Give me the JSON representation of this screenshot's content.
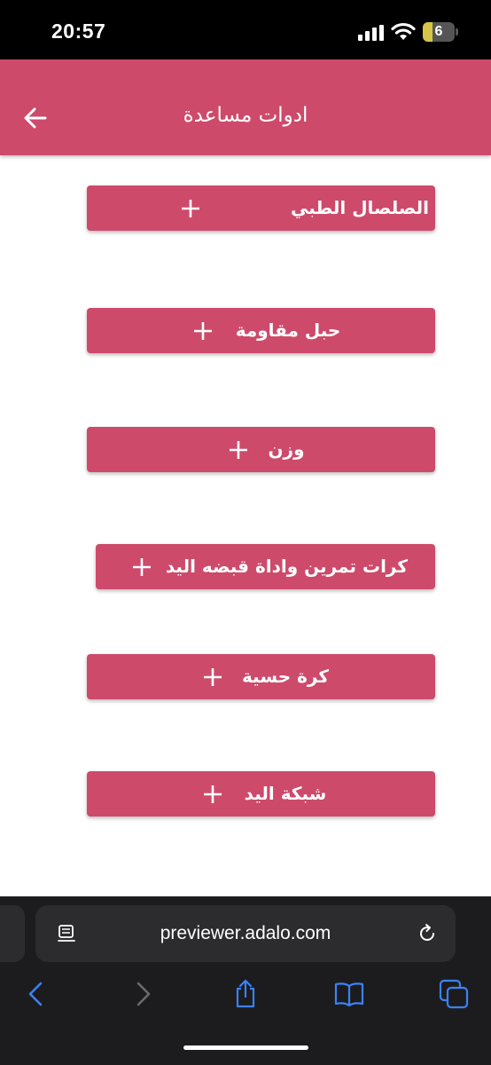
{
  "status_bar": {
    "time": "20:57",
    "battery_level": "6"
  },
  "header": {
    "title": "ادوات مساعدة",
    "background_color": "#cd4a6b"
  },
  "tools": [
    {
      "label": "الصلصال الطبي",
      "icon": "plus-icon"
    },
    {
      "label": "حبل مقاومة",
      "icon": "plus-icon"
    },
    {
      "label": "وزن",
      "icon": "plus-icon"
    },
    {
      "label": "كرات تمرين واداة قبضه اليد",
      "icon": "plus-icon"
    },
    {
      "label": "كرة حسية",
      "icon": "plus-icon"
    },
    {
      "label": "شبكة اليد",
      "icon": "plus-icon"
    }
  ],
  "browser": {
    "url": "previewer.adalo.com",
    "toolbar_icons": [
      "back-icon",
      "forward-icon",
      "share-icon",
      "bookmarks-icon",
      "tabs-icon"
    ],
    "accent_color": "#3b82f6"
  }
}
